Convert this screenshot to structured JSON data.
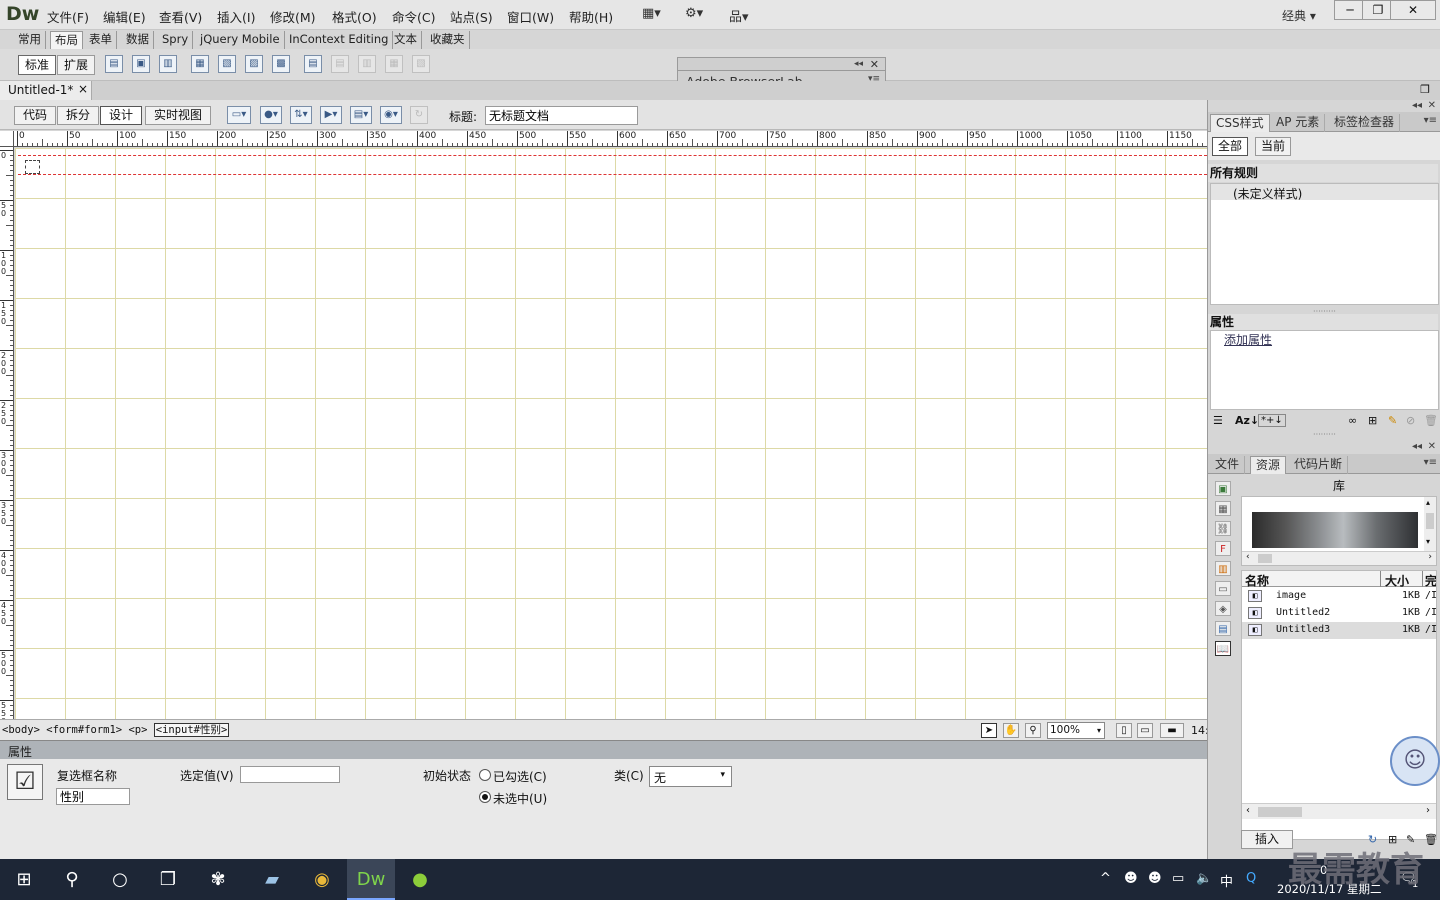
{
  "app": {
    "logo": "Dw",
    "menu": [
      "文件(F)",
      "编辑(E)",
      "查看(V)",
      "插入(I)",
      "修改(M)",
      "格式(O)",
      "命令(C)",
      "站点(S)",
      "窗口(W)",
      "帮助(H)"
    ],
    "workspace": "经典",
    "window_buttons": [
      "─",
      "❐",
      "✕"
    ]
  },
  "insert_bar": {
    "tabs": [
      "常用",
      "布局",
      "表单",
      "数据",
      "Spry",
      "jQuery Mobile",
      "InContext Editing",
      "文本",
      "收藏夹"
    ],
    "active_tab": "布局",
    "mode_buttons": [
      "标准",
      "扩展"
    ]
  },
  "browserlab": {
    "title": "Adobe BrowserLab"
  },
  "document": {
    "tab_label": "Untitled-1*",
    "close_glyph": "×",
    "view_buttons": [
      "代码",
      "拆分",
      "设计",
      "实时视图"
    ],
    "active_view": "设计",
    "title_label": "标题:",
    "title_value": "无标题文档"
  },
  "ruler": {
    "top_marks": [
      "0",
      "50",
      "100",
      "150",
      "200",
      "250",
      "300",
      "350",
      "400",
      "450",
      "500",
      "550",
      "600",
      "650",
      "700",
      "750",
      "800",
      "850",
      "900",
      "950",
      "1000",
      "1050",
      "1100",
      "1150"
    ],
    "left_marks": [
      "0",
      "5\n0",
      "1\n0\n0",
      "1\n5\n0",
      "2\n0\n0",
      "2\n5\n0",
      "3\n0\n0",
      "3\n5\n0",
      "4\n0\n0",
      "4\n5\n0",
      "5\n0\n0",
      "5\n5\n0"
    ]
  },
  "status_bar": {
    "tags": [
      "<body>",
      "<form#form1>",
      "<p>",
      "<input#性别>"
    ],
    "zoom": "100%",
    "window_size": "14:"
  },
  "properties": {
    "header": "属性",
    "checkbox_name_label": "复选框名称",
    "checkbox_name_value": "性别",
    "checked_value_label": "选定值(V)",
    "checked_value": "",
    "initial_state_label": "初始状态",
    "option_checked": "已勾选(C)",
    "option_unchecked": "未选中(U)",
    "class_label": "类(C)",
    "class_value": "无"
  },
  "css_panel": {
    "tabs": [
      "CSS样式",
      "AP 元素",
      "标签检查器"
    ],
    "buttons": [
      "全部",
      "当前"
    ],
    "all_rules_label": "所有规则",
    "undefined_style": "(未定义样式)",
    "properties_label": "属性",
    "add_property": "添加属性"
  },
  "files_panel": {
    "tabs": [
      "文件",
      "资源",
      "代码片断"
    ],
    "library_title": "库",
    "columns": [
      "名称",
      "大小",
      "完"
    ],
    "items": [
      {
        "name": "image",
        "size": "1KB",
        "path": "/I"
      },
      {
        "name": "Untitled2",
        "size": "1KB",
        "path": "/I"
      },
      {
        "name": "Untitled3",
        "size": "1KB",
        "path": "/I"
      }
    ],
    "insert_button": "插入"
  },
  "taskbar": {
    "date": "2020/11/17 星期二",
    "time": "0",
    "ime": "中",
    "notifications": "1"
  },
  "watermark": "最需教育",
  "colors": {
    "grid": "#ddd9a6",
    "form_outline": "#dd3333",
    "taskbar": "#1d2636"
  }
}
